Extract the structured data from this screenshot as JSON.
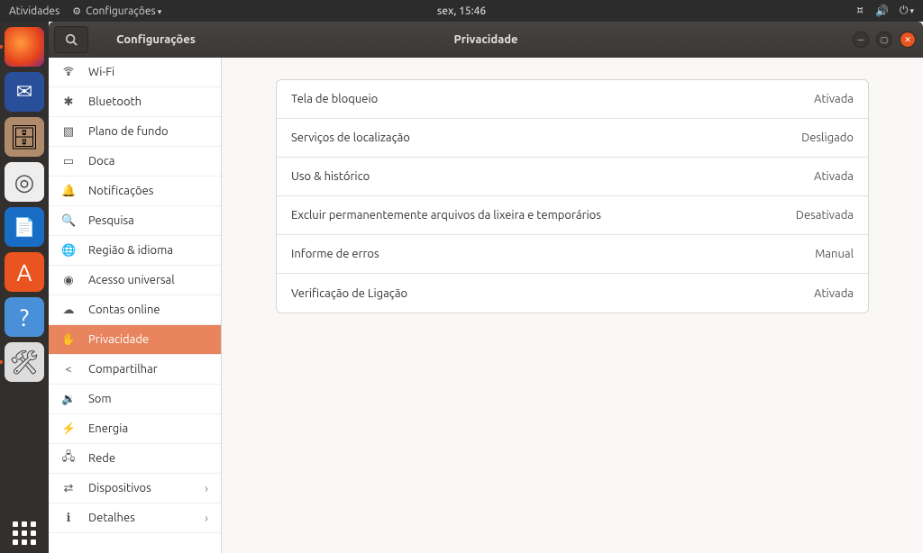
{
  "top_panel": {
    "activities": "Atividades",
    "app_menu": "Configurações",
    "clock": "sex, 15:46"
  },
  "dock": {
    "items": [
      {
        "key": "firefox",
        "label": "Firefox",
        "running": true
      },
      {
        "key": "thunderbird",
        "label": "Thunderbird",
        "running": false
      },
      {
        "key": "files",
        "label": "Arquivos",
        "running": false
      },
      {
        "key": "rhythmbox",
        "label": "Rhythmbox",
        "running": false
      },
      {
        "key": "writer",
        "label": "LibreOffice Writer",
        "running": false
      },
      {
        "key": "software",
        "label": "Ubuntu Software",
        "running": false
      },
      {
        "key": "help",
        "label": "Ajuda",
        "running": false
      },
      {
        "key": "tweaks",
        "label": "Ajustes",
        "running": true
      }
    ]
  },
  "window": {
    "app_title": "Configurações",
    "page_title": "Privacidade"
  },
  "sidebar": {
    "items": [
      {
        "label": "Wi-Fi",
        "icon": "wifi"
      },
      {
        "label": "Bluetooth",
        "icon": "bluetooth"
      },
      {
        "label": "Plano de fundo",
        "icon": "background"
      },
      {
        "label": "Doca",
        "icon": "dock"
      },
      {
        "label": "Notificações",
        "icon": "bell"
      },
      {
        "label": "Pesquisa",
        "icon": "search"
      },
      {
        "label": "Região & idioma",
        "icon": "globe"
      },
      {
        "label": "Acesso universal",
        "icon": "accessibility"
      },
      {
        "label": "Contas online",
        "icon": "accounts"
      },
      {
        "label": "Privacidade",
        "icon": "hand",
        "selected": true
      },
      {
        "label": "Compartilhar",
        "icon": "share"
      },
      {
        "label": "Som",
        "icon": "sound"
      },
      {
        "label": "Energia",
        "icon": "power"
      },
      {
        "label": "Rede",
        "icon": "network"
      },
      {
        "label": "Dispositivos",
        "icon": "devices",
        "chevron": true
      },
      {
        "label": "Detalhes",
        "icon": "info",
        "chevron": true
      }
    ]
  },
  "settings": {
    "rows": [
      {
        "label": "Tela de bloqueio",
        "value": "Ativada"
      },
      {
        "label": "Serviços de localização",
        "value": "Desligado"
      },
      {
        "label": "Uso & histórico",
        "value": "Ativada"
      },
      {
        "label": "Excluir permanentemente arquivos da lixeira e temporários",
        "value": "Desativada"
      },
      {
        "label": "Informe de erros",
        "value": "Manual"
      },
      {
        "label": "Verificação de Ligação",
        "value": "Ativada"
      }
    ]
  }
}
